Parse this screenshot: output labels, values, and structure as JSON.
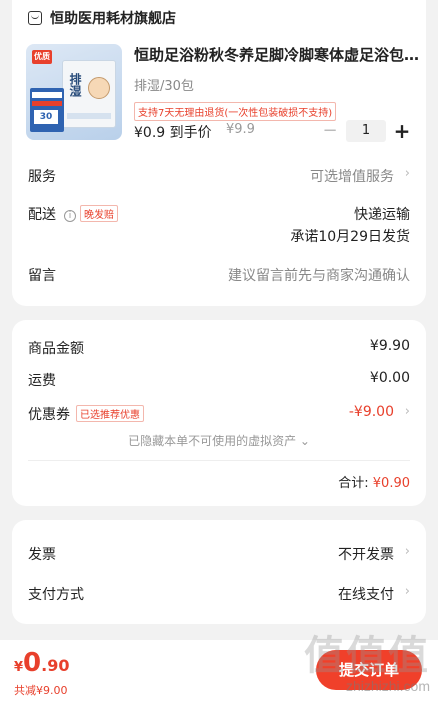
{
  "store": {
    "name": "恒助医用耗材旗舰店"
  },
  "product": {
    "title": "恒助足浴粉秋冬养足脚冷脚寒体虚足浴包…",
    "spec": "排湿/30包",
    "return_tag": "支持7天无理由退货(一次性包装破损不支持)",
    "price": "¥0.9 到手价",
    "original_price": "¥9.9",
    "quantity": "1",
    "minus": "−",
    "plus": "+",
    "thumb_badge": "优质",
    "thumb_pack_text": "排湿",
    "thumb_box_count": "30"
  },
  "service": {
    "label": "服务",
    "value": "可选增值服务"
  },
  "delivery": {
    "label": "配送",
    "late_tag": "晚发赔",
    "info": "i",
    "method": "快递运输",
    "promise": "承诺10月29日发货"
  },
  "message": {
    "label": "留言",
    "placeholder": "建议留言前先与商家沟通确认"
  },
  "amounts": {
    "goods_label": "商品金额",
    "goods_value": "¥9.90",
    "shipping_label": "运费",
    "shipping_value": "¥0.00",
    "coupon_label": "优惠券",
    "coupon_tag": "已选推荐优惠",
    "coupon_value": "-¥9.00",
    "hidden_note": "已隐藏本单不可使用的虚拟资产 ⌄",
    "total_label": "合计:",
    "total_value": "¥0.90"
  },
  "invoice": {
    "label": "发票",
    "value": "不开发票"
  },
  "payment": {
    "label": "支付方式",
    "value": "在线支付"
  },
  "bottom": {
    "yen": "¥",
    "amount_int": "0",
    "amount_dec": ".90",
    "saved": "共减¥9.00",
    "submit": "提交订单"
  },
  "watermark": {
    "big": "值值值",
    "small": "zhizhizhi.com"
  },
  "chevron": "›",
  "colors": {
    "accent": "#f0402a",
    "bg": "#f2f2f2"
  }
}
